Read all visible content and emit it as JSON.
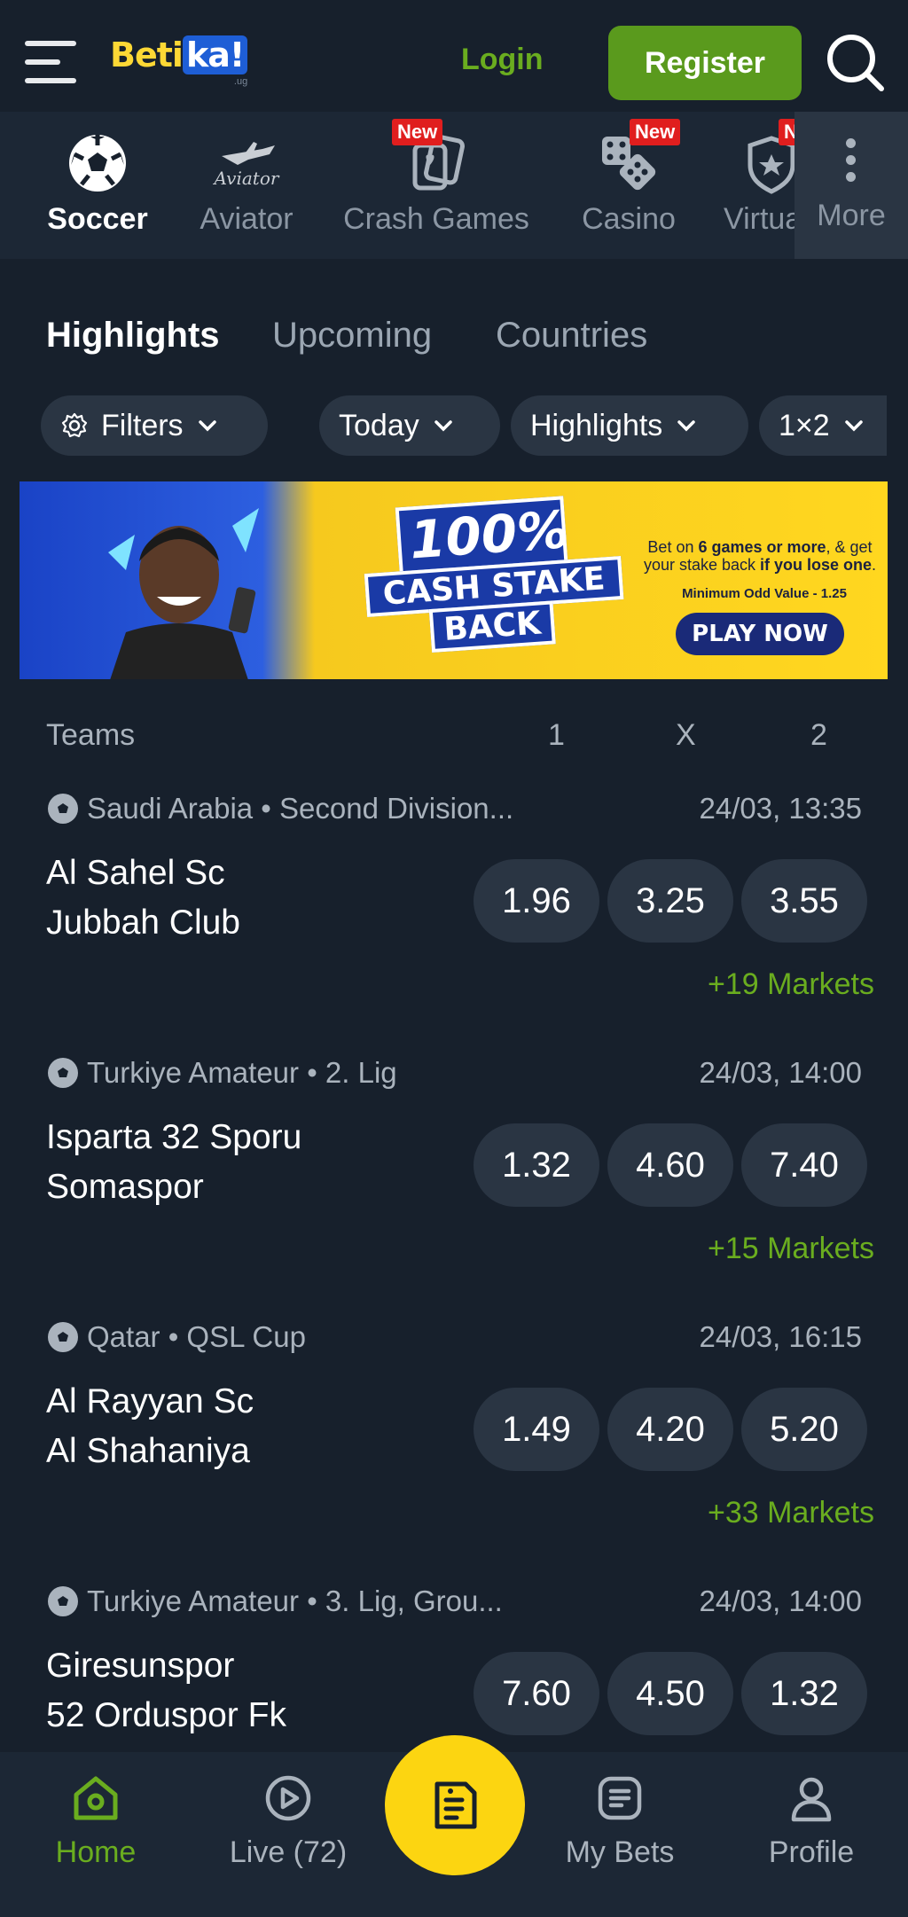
{
  "header": {
    "logo_text": "Betika!",
    "logo_tld": ".ug",
    "login_label": "Login",
    "register_label": "Register"
  },
  "categories": [
    {
      "label": "Soccer",
      "icon": "soccer-ball-icon",
      "active": true
    },
    {
      "label": "Aviator",
      "icon": "aviator-plane-icon"
    },
    {
      "label": "Crash Games",
      "icon": "cards-icon",
      "badge": "New"
    },
    {
      "label": "Casino",
      "icon": "dice-icon",
      "badge": "New"
    },
    {
      "label": "Virtua",
      "icon": "virtuals-icon",
      "badge": "N"
    }
  ],
  "more_label": "More",
  "tabs": [
    {
      "label": "Highlights",
      "active": true
    },
    {
      "label": "Upcoming"
    },
    {
      "label": "Countries"
    }
  ],
  "filters": {
    "filters_label": "Filters",
    "day_label": "Today",
    "sort_label": "Highlights",
    "market_label": "1×2"
  },
  "banner": {
    "line1": "100%",
    "line2": "CASH STAKE",
    "line3": "BACK",
    "side_pre": "Bet on ",
    "side_b1": "6 games or more",
    "side_mid": ", & get your stake back ",
    "side_b2": "if you lose one",
    "side_end": ".",
    "min_odd": "Minimum Odd Value - 1.25",
    "cta": "PLAY NOW"
  },
  "table_header": {
    "teams": "Teams",
    "home": "1",
    "draw": "X",
    "away": "2"
  },
  "matches": [
    {
      "league": "Saudi Arabia • Second Division...",
      "time": "24/03, 13:35",
      "home": "Al Sahel Sc",
      "away": "Jubbah Club",
      "odds": [
        "1.96",
        "3.25",
        "3.55"
      ],
      "markets": "+19 Markets"
    },
    {
      "league": "Turkiye Amateur • 2. Lig",
      "time": "24/03, 14:00",
      "home": "Isparta 32 Sporu",
      "away": "Somaspor",
      "odds": [
        "1.32",
        "4.60",
        "7.40"
      ],
      "markets": "+15 Markets"
    },
    {
      "league": "Qatar • QSL Cup",
      "time": "24/03, 16:15",
      "home": "Al Rayyan Sc",
      "away": "Al Shahaniya",
      "odds": [
        "1.49",
        "4.20",
        "5.20"
      ],
      "markets": "+33 Markets"
    },
    {
      "league": "Turkiye Amateur • 3. Lig, Grou...",
      "time": "24/03, 14:00",
      "home": "Giresunspor",
      "away": "52 Orduspor Fk",
      "odds": [
        "7.60",
        "4.50",
        "1.32"
      ],
      "markets": ""
    }
  ],
  "bottom_nav": {
    "home": "Home",
    "live": "Live (72)",
    "my_bets": "My Bets",
    "profile": "Profile"
  },
  "colors": {
    "background": "#17202c",
    "accent_green": "#6aad1f",
    "register_green": "#5a9a1d",
    "betslip_yellow": "#fcd511",
    "chip_bg": "#2a3543"
  }
}
